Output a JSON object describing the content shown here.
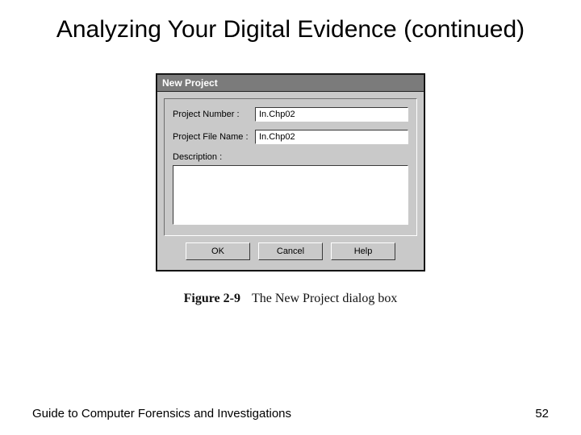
{
  "slide": {
    "title": "Analyzing Your Digital Evidence (continued)"
  },
  "dialog": {
    "titlebar": "New Project",
    "fields": {
      "project_number": {
        "label": "Project Number :",
        "value": "In.Chp02"
      },
      "project_file_name": {
        "label": "Project File Name :",
        "value": "In.Chp02"
      },
      "description": {
        "label": "Description :",
        "value": ""
      }
    },
    "buttons": {
      "ok": "OK",
      "cancel": "Cancel",
      "help": "Help"
    }
  },
  "caption": {
    "figure_label": "Figure 2-9",
    "figure_text": "The New Project dialog box"
  },
  "footer": {
    "book_title": "Guide to Computer Forensics and Investigations",
    "page_number": "52"
  }
}
